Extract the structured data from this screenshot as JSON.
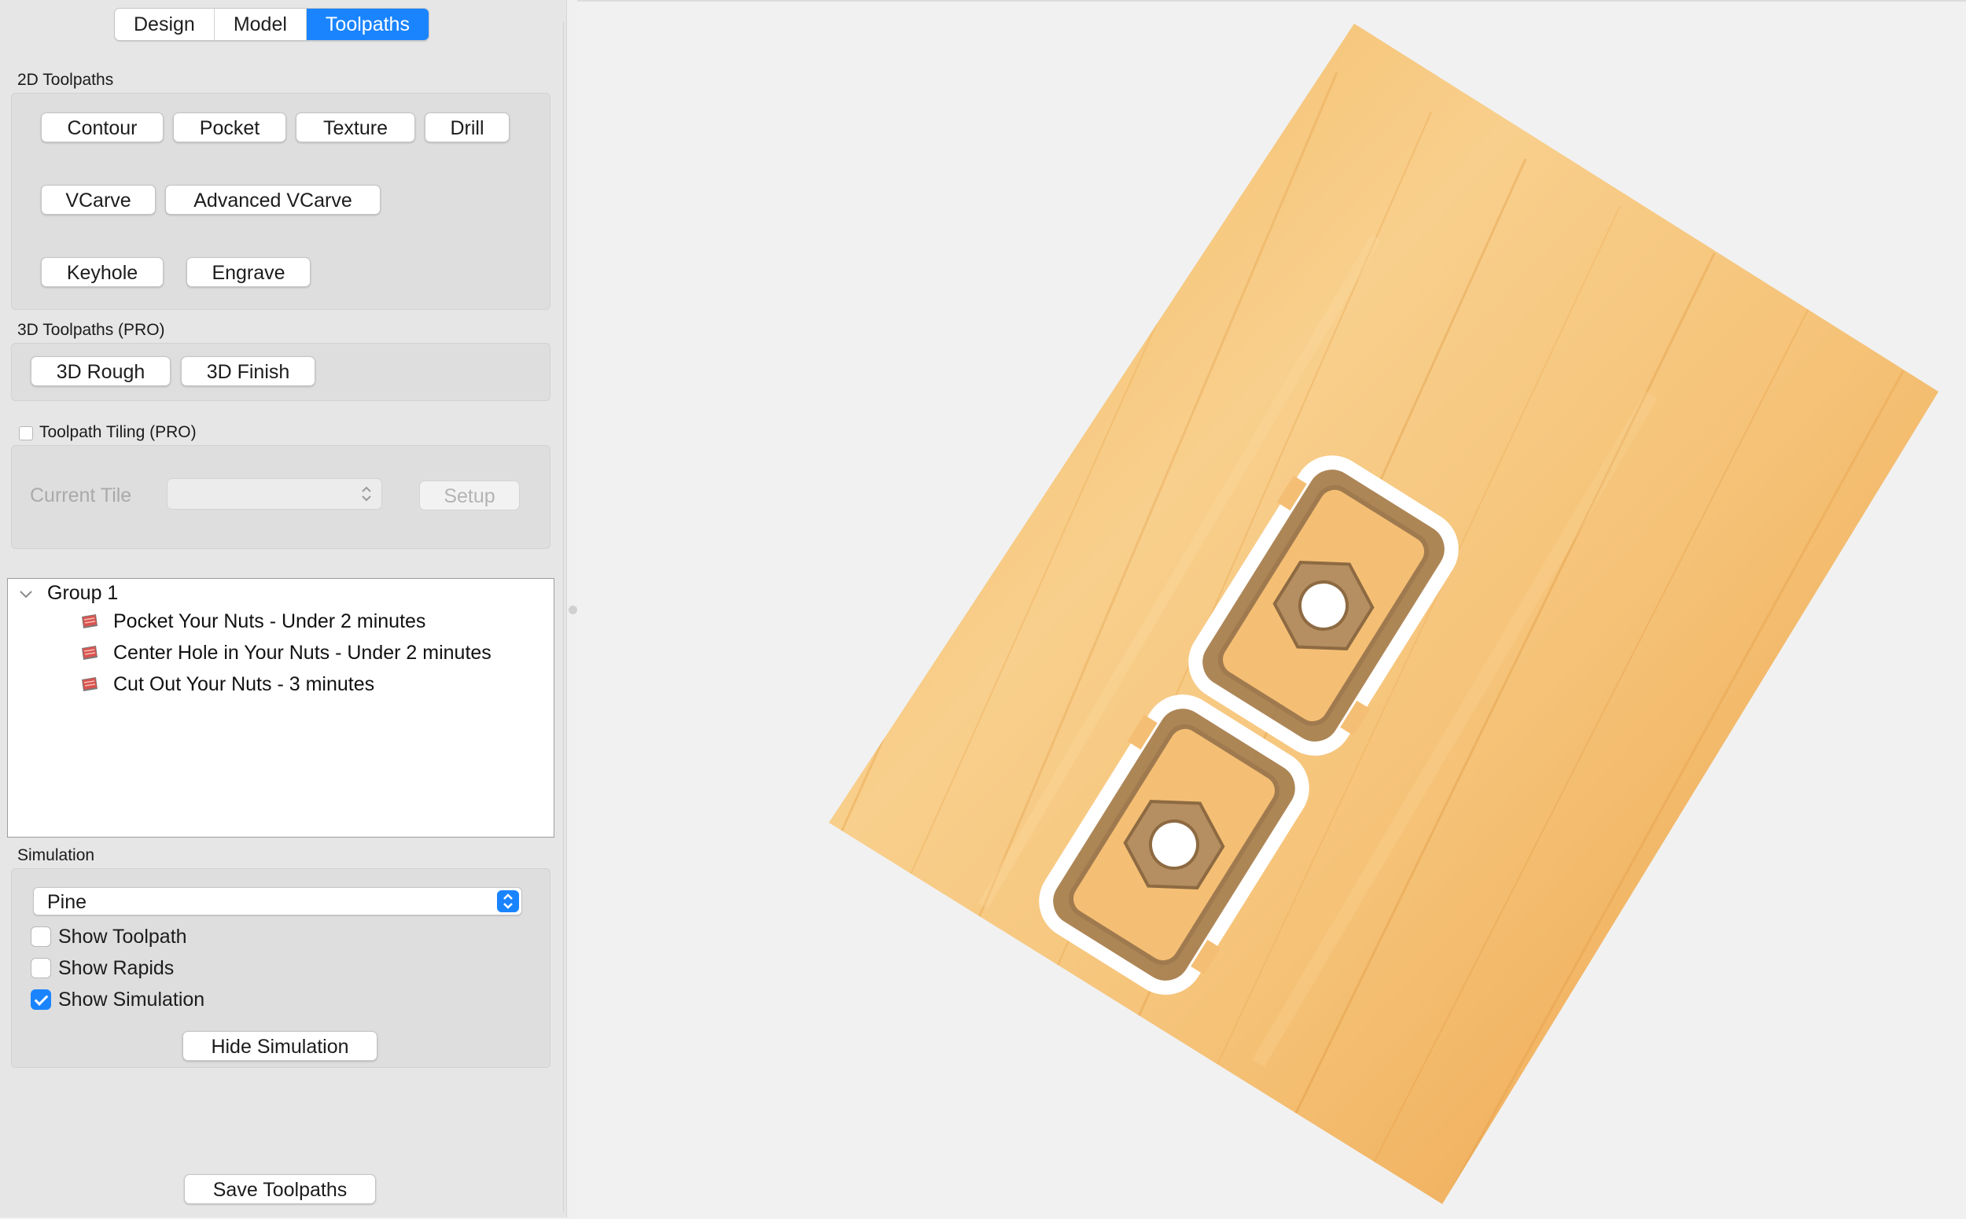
{
  "tabs": [
    {
      "label": "Design",
      "active": false
    },
    {
      "label": "Model",
      "active": false
    },
    {
      "label": "Toolpaths",
      "active": true
    }
  ],
  "toolpaths_2d": {
    "title": "2D Toolpaths",
    "buttons": [
      "Contour",
      "Pocket",
      "Texture",
      "Drill",
      "VCarve",
      "Advanced VCarve",
      "Keyhole",
      "Engrave"
    ]
  },
  "toolpaths_3d": {
    "title": "3D Toolpaths (PRO)",
    "buttons": [
      "3D Rough",
      "3D Finish"
    ]
  },
  "tiling": {
    "label": "Toolpath Tiling (PRO)",
    "checked": false,
    "current_tile_label": "Current Tile",
    "setup_label": "Setup"
  },
  "tree": {
    "group": "Group 1",
    "items": [
      "Pocket Your Nuts - Under 2 minutes",
      "Center Hole in Your Nuts - Under 2 minutes",
      "Cut Out Your Nuts - 3 minutes"
    ]
  },
  "simulation": {
    "title": "Simulation",
    "material": "Pine",
    "show_toolpath": {
      "label": "Show Toolpath",
      "checked": false
    },
    "show_rapids": {
      "label": "Show Rapids",
      "checked": false
    },
    "show_simulation": {
      "label": "Show Simulation",
      "checked": true
    },
    "hide_button": "Hide Simulation"
  },
  "save_button": "Save Toolpaths",
  "colors": {
    "accent": "#1a84ff",
    "wood_light": "#f6c47a",
    "wood_dark": "#e49a3c"
  }
}
